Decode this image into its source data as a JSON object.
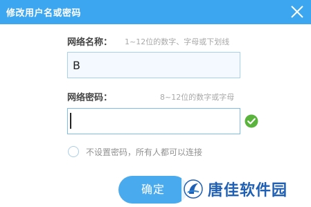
{
  "dialog": {
    "title": "修改用户名或密码",
    "close_icon": "close-icon"
  },
  "network_name": {
    "label": "网络名称：",
    "hint": "1~12位的数字、字母或下划线",
    "value": "B"
  },
  "network_password": {
    "label": "网络密码：",
    "hint": "8~12位的数字或字母",
    "value": "",
    "valid_icon": "check-circle-icon"
  },
  "no_password_option": {
    "label": "不设置密码，所有人都可以连接",
    "checked": false
  },
  "confirm_button": {
    "label": "确定"
  },
  "watermark": {
    "text": "唐佳软件园"
  },
  "colors": {
    "titlebar": "#3ca6f0",
    "button": "#4aaaee",
    "valid": "#5ab33d",
    "watermark": "#1f5fb4"
  }
}
